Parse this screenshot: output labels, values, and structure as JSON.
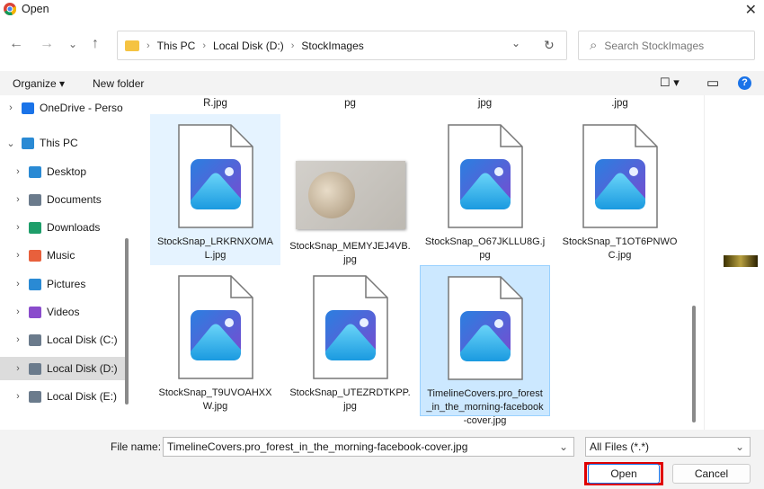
{
  "window": {
    "title": "Open",
    "close": "✕"
  },
  "nav": {
    "back": "←",
    "forward": "→",
    "recent": "⌄",
    "up": "↑"
  },
  "address": {
    "parts": [
      "This PC",
      "Local Disk (D:)",
      "StockImages"
    ],
    "chevron": "⌄",
    "refresh": "↻"
  },
  "search": {
    "placeholder": "Search StockImages",
    "icon": "⌕"
  },
  "toolbar": {
    "organize": "Organize ▾",
    "new_folder": "New folder",
    "view": "☐ ▾",
    "pane": "▭",
    "help": "?"
  },
  "sidebar": {
    "items": [
      {
        "label": "OneDrive - Perso",
        "color": "#1a73e8",
        "expanded": false
      },
      {
        "label": "This PC",
        "color": "#2a8ad4",
        "expanded": true
      },
      {
        "label": "Desktop",
        "color": "#2a8ad4"
      },
      {
        "label": "Documents",
        "color": "#6b7b8c"
      },
      {
        "label": "Downloads",
        "color": "#1e9e6a"
      },
      {
        "label": "Music",
        "color": "#e8603c"
      },
      {
        "label": "Pictures",
        "color": "#2a8ad4"
      },
      {
        "label": "Videos",
        "color": "#8a4ccc"
      },
      {
        "label": "Local Disk (C:)",
        "color": "#6b7b8c"
      },
      {
        "label": "Local Disk (D:)",
        "color": "#6b7b8c",
        "selected": true
      },
      {
        "label": "Local Disk (E:)",
        "color": "#6b7b8c"
      }
    ]
  },
  "partial_labels": [
    "R.jpg",
    "pg",
    "jpg",
    ".jpg"
  ],
  "files": [
    {
      "name": "StockSnap_LRKRNXOMAL.jpg",
      "type": "icon",
      "state": "hover"
    },
    {
      "name": "StockSnap_MEMYJEJ4VB.jpg",
      "type": "photo"
    },
    {
      "name": "StockSnap_O67JKLLU8G.jpg",
      "type": "icon"
    },
    {
      "name": "StockSnap_T1OT6PNWOC.jpg",
      "type": "icon"
    },
    {
      "name": "StockSnap_T9UVOAHXXW.jpg",
      "type": "icon"
    },
    {
      "name": "StockSnap_UTEZRDTKPP.jpg",
      "type": "icon"
    },
    {
      "name": "TimelineCovers.pro_forest_in_the_morning-facebook-cover.jpg",
      "type": "icon",
      "state": "selected"
    }
  ],
  "footer": {
    "file_name_label": "File name:",
    "file_name_value": "TimelineCovers.pro_forest_in_the_morning-facebook-cover.jpg",
    "filter": "All Files (*.*)",
    "open": "Open",
    "cancel": "Cancel",
    "highlight_color": "#e00000"
  }
}
